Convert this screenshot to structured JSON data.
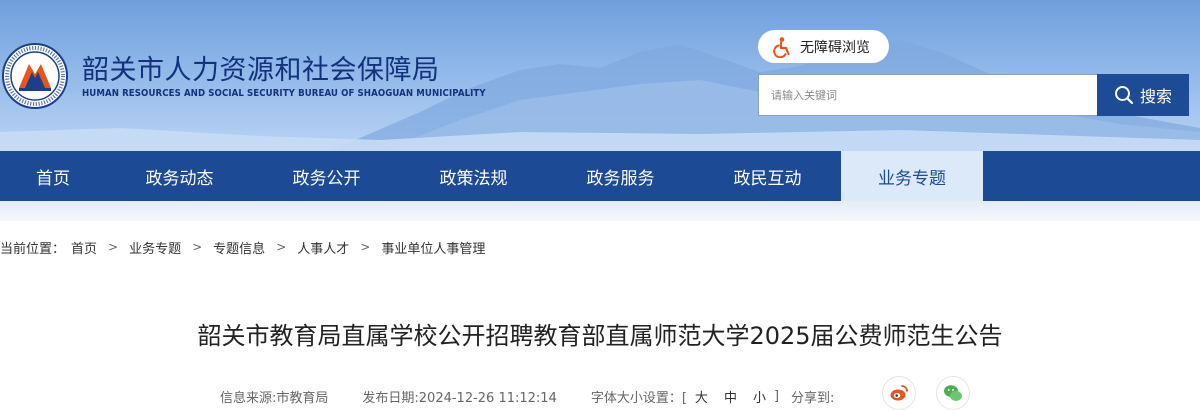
{
  "header": {
    "title_cn": "韶关市人力资源和社会保障局",
    "title_en": "HUMAN RESOURCES AND SOCIAL SECURITY BUREAU OF SHAOGUAN MUNICIPALITY",
    "accessibility_label": "无障碍浏览",
    "search": {
      "placeholder": "请输入关键词",
      "button_label": "搜索"
    },
    "colors": {
      "header_blue": "#6f9fdc",
      "title_navy": "#14327c",
      "accent_orange": "#e8541e"
    }
  },
  "nav": {
    "items": [
      {
        "label": "首页"
      },
      {
        "label": "政务动态"
      },
      {
        "label": "政务公开"
      },
      {
        "label": "政策法规"
      },
      {
        "label": "政务服务"
      },
      {
        "label": "政民互动"
      },
      {
        "label": "业务专题",
        "active": true
      }
    ],
    "colors": {
      "bar": "#1c4a94",
      "active_bg": "#dbe9f8"
    }
  },
  "breadcrumb": {
    "label": "当前位置：",
    "items": [
      "首页",
      "业务专题",
      "专题信息",
      "人事人才",
      "事业单位人事管理"
    ],
    "separator": ">"
  },
  "article": {
    "title": "韶关市教育局直属学校公开招聘教育部直属师范大学2025届公费师范生公告",
    "meta": {
      "source": "信息来源:市教育局",
      "date": "发布日期:2024-12-26 11:12:14",
      "font_size_label": "字体大小设置：[",
      "sizes": [
        "大",
        "中",
        "小"
      ],
      "font_size_end": "]",
      "share_label": "分享到:"
    },
    "share_icons": [
      "weibo-icon",
      "wechat-icon"
    ]
  }
}
